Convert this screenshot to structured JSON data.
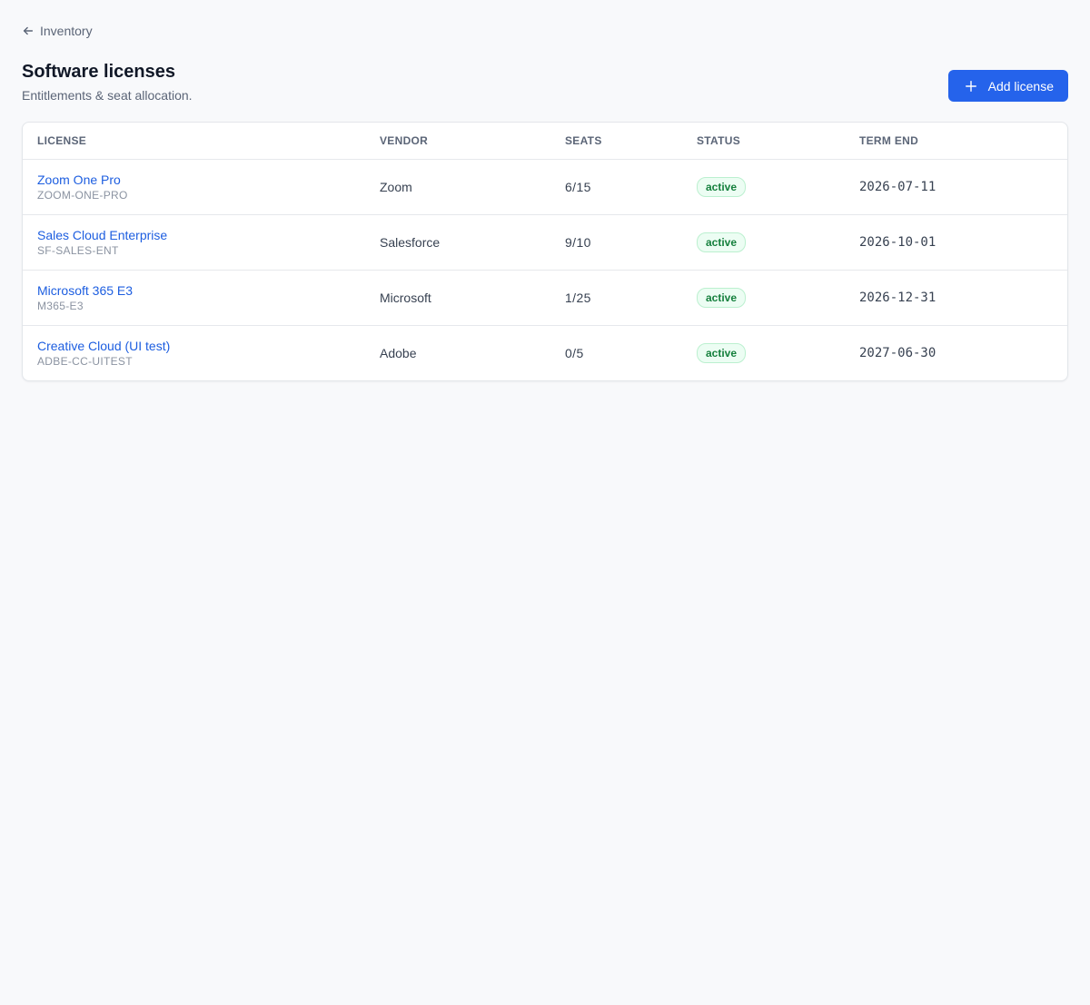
{
  "nav": {
    "back_label": "Inventory",
    "back_icon": "arrow-left-icon"
  },
  "header": {
    "title": "Software licenses",
    "subtitle": "Entitlements & seat allocation.",
    "add_button_label": "Add license",
    "add_button_icon": "plus-icon",
    "accent_color": "#2563eb"
  },
  "table": {
    "columns": {
      "license": "LICENSE",
      "vendor": "VENDOR",
      "seats": "SEATS",
      "status": "STATUS",
      "term_end": "TERM END"
    },
    "rows": [
      {
        "name": "Zoom One Pro",
        "code": "ZOOM-ONE-PRO",
        "vendor": "Zoom",
        "seats": "6/15",
        "status": "active",
        "term_end": "2026-07-11"
      },
      {
        "name": "Sales Cloud Enterprise",
        "code": "SF-SALES-ENT",
        "vendor": "Salesforce",
        "seats": "9/10",
        "status": "active",
        "term_end": "2026-10-01"
      },
      {
        "name": "Microsoft 365 E3",
        "code": "M365-E3",
        "vendor": "Microsoft",
        "seats": "1/25",
        "status": "active",
        "term_end": "2026-12-31"
      },
      {
        "name": "Creative Cloud (UI test)",
        "code": "ADBE-CC-UITEST",
        "vendor": "Adobe",
        "seats": "0/5",
        "status": "active",
        "term_end": "2027-06-30"
      }
    ],
    "status_color": "#15803d"
  }
}
